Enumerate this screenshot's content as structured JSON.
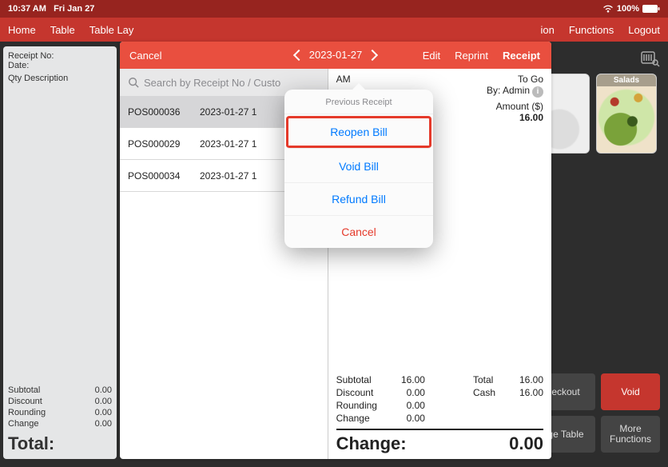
{
  "status": {
    "time": "10:37 AM",
    "date": "Fri Jan 27",
    "battery": "100%"
  },
  "menu": {
    "home": "Home",
    "table": "Table",
    "layout": "Table Lay",
    "ion": "ion",
    "functions": "Functions",
    "logout": "Logout"
  },
  "left": {
    "receipt_no_label": "Receipt No:",
    "date_label": "Date:",
    "cols": "Qty  Description",
    "subtotal_label": "Subtotal",
    "subtotal": "0.00",
    "discount_label": "Discount",
    "discount": "0.00",
    "rounding_label": "Rounding",
    "rounding": "0.00",
    "change_label": "Change",
    "change": "0.00",
    "total_label": "Total:"
  },
  "tiles": {
    "salads": "Salads"
  },
  "buttons": {
    "checkout": "eckout",
    "void": "Void",
    "table": "ge Table",
    "more": "More Functions"
  },
  "modal": {
    "cancel": "Cancel",
    "date": "2023-01-27",
    "edit": "Edit",
    "reprint": "Reprint",
    "receipt": "Receipt",
    "search_placeholder": "Search by Receipt No / Custo",
    "rows": [
      {
        "no": "POS000036",
        "date": "2023-01-27 1"
      },
      {
        "no": "POS000029",
        "date": "2023-01-27 1"
      },
      {
        "no": "POS000034",
        "date": "2023-01-27 1"
      }
    ]
  },
  "detail": {
    "time_suffix": "AM",
    "mode": "To Go",
    "by": "By: Admin",
    "amount_label": "Amount ($)",
    "amount": "16.00",
    "subtotal_label": "Subtotal",
    "subtotal": "16.00",
    "discount_label": "Discount",
    "discount": "0.00",
    "rounding_label": "Rounding",
    "rounding": "0.00",
    "change_label": "Change",
    "change": "0.00",
    "total_label": "Total",
    "total": "16.00",
    "cash_label": "Cash",
    "cash": "16.00",
    "big_change_label": "Change:",
    "big_change": "0.00"
  },
  "popover": {
    "title": "Previous Receipt",
    "reopen": "Reopen Bill",
    "void": "Void Bill",
    "refund": "Refund Bill",
    "cancel": "Cancel"
  }
}
